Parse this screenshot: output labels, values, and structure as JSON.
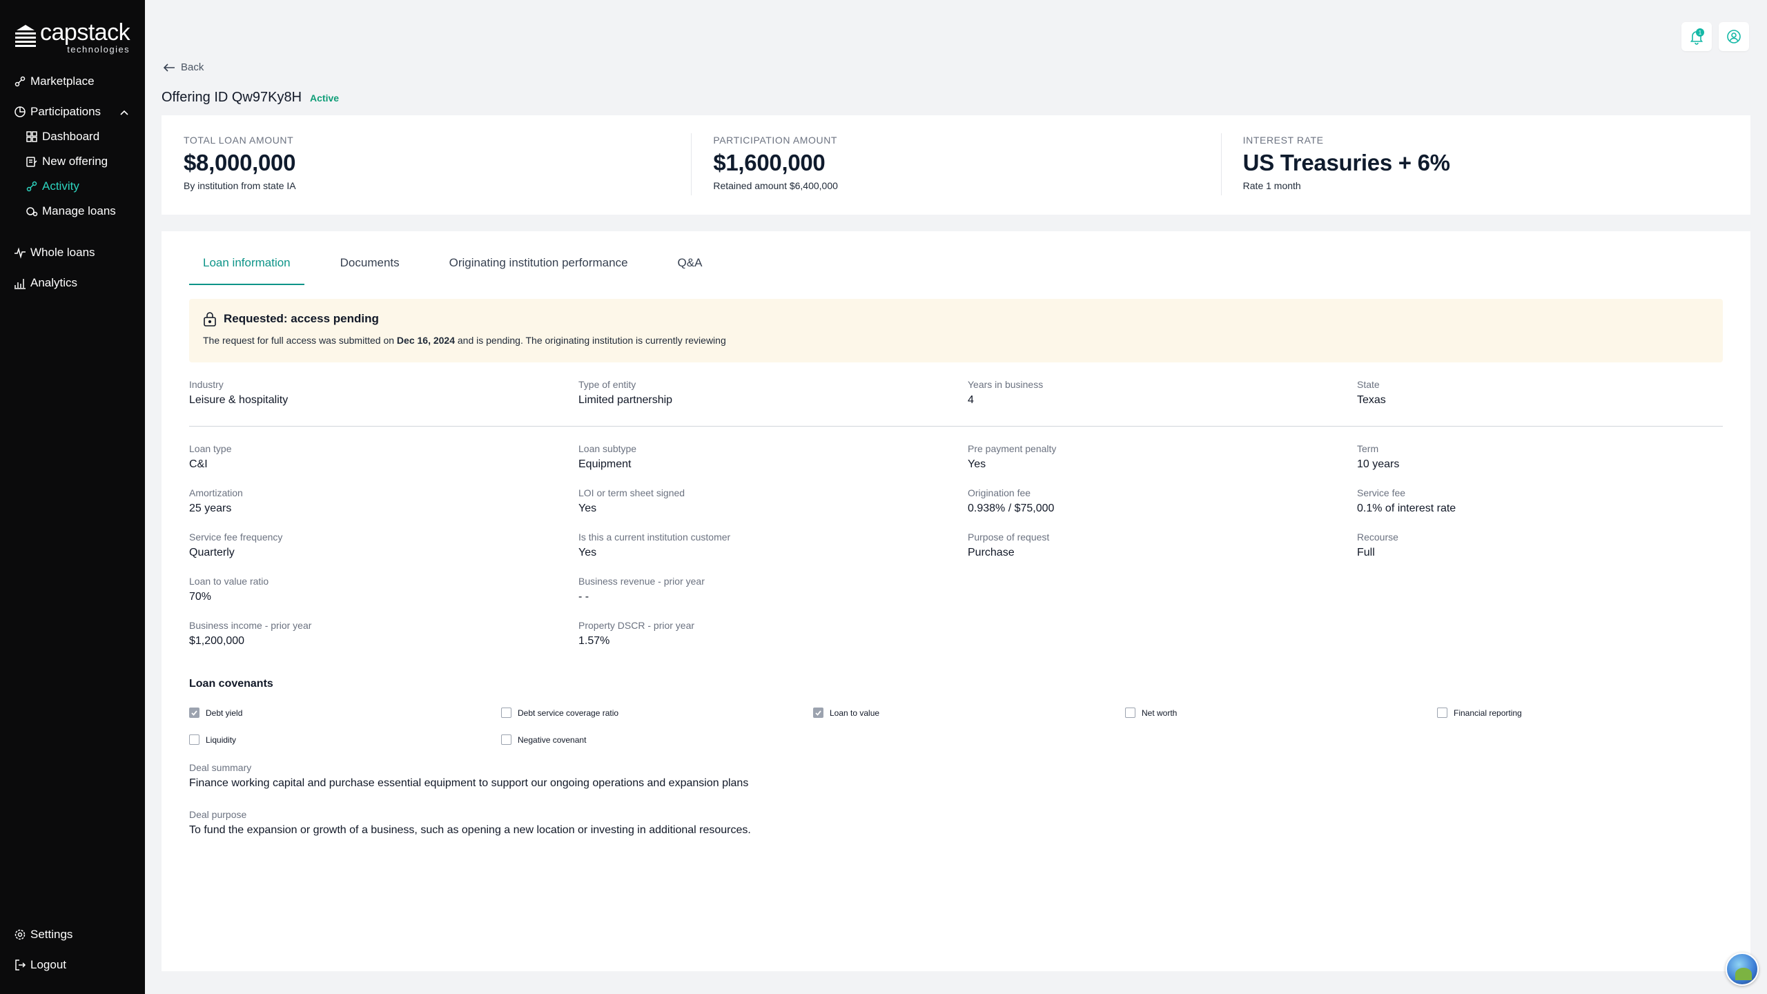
{
  "brand": {
    "name": "capstack",
    "tagline": "technologies"
  },
  "sidebar": {
    "items": [
      {
        "label": "Marketplace",
        "icon": "marketplace-icon"
      },
      {
        "label": "Participations",
        "icon": "participations-icon",
        "expanded": true
      },
      {
        "label": "Dashboard",
        "icon": "dashboard-icon"
      },
      {
        "label": "New offering",
        "icon": "new-offering-icon"
      },
      {
        "label": "Activity",
        "icon": "activity-icon",
        "active": true
      },
      {
        "label": "Manage loans",
        "icon": "manage-loans-icon"
      },
      {
        "label": "Whole loans",
        "icon": "whole-loans-icon"
      },
      {
        "label": "Analytics",
        "icon": "analytics-icon"
      }
    ],
    "bottom": [
      {
        "label": "Settings",
        "icon": "gear-icon"
      },
      {
        "label": "Logout",
        "icon": "logout-icon"
      }
    ]
  },
  "topbar": {
    "notification_count": "1"
  },
  "header": {
    "back_label": "Back",
    "title": "Offering ID Qw97Ky8H",
    "status": "Active"
  },
  "stats": [
    {
      "label": "Total loan amount",
      "value": "$8,000,000",
      "sub": "By institution from state IA"
    },
    {
      "label": "Participation amount",
      "value": "$1,600,000",
      "sub": "Retained amount $6,400,000"
    },
    {
      "label": "Interest rate",
      "value": "US Treasuries + 6%",
      "sub": "Rate 1 month"
    }
  ],
  "tabs": [
    {
      "label": "Loan information",
      "active": true
    },
    {
      "label": "Documents"
    },
    {
      "label": "Originating institution performance"
    },
    {
      "label": "Q&A"
    }
  ],
  "alert": {
    "title": "Requested: access pending",
    "text_before": "The request for full access was submitted on ",
    "date": "Dec 16, 2024",
    "text_after": " and is pending. The originating institution is currently reviewing"
  },
  "company_fields": [
    {
      "label": "Industry",
      "value": "Leisure & hospitality"
    },
    {
      "label": "Type of entity",
      "value": "Limited partnership"
    },
    {
      "label": "Years in business",
      "value": "4"
    },
    {
      "label": "State",
      "value": "Texas"
    }
  ],
  "loan_fields": [
    {
      "label": "Loan type",
      "value": "C&I"
    },
    {
      "label": "Loan subtype",
      "value": "Equipment"
    },
    {
      "label": "Pre payment penalty",
      "value": "Yes"
    },
    {
      "label": "Term",
      "value": "10 years"
    },
    {
      "label": "Amortization",
      "value": "25 years"
    },
    {
      "label": "LOI or term sheet signed",
      "value": "Yes"
    },
    {
      "label": "Origination fee",
      "value": "0.938% / $75,000"
    },
    {
      "label": "Service fee",
      "value": "0.1% of interest rate"
    },
    {
      "label": "Service fee frequency",
      "value": "Quarterly"
    },
    {
      "label": "Is this a current institution customer",
      "value": "Yes"
    },
    {
      "label": "Purpose of request",
      "value": "Purchase"
    },
    {
      "label": "Recourse",
      "value": "Full"
    },
    {
      "label": "Loan to value ratio",
      "value": "70%"
    },
    {
      "label": "Business revenue - prior year",
      "value": "- -"
    },
    {
      "label": "Business income - prior year",
      "value": "$1,200,000"
    },
    {
      "label": "Property DSCR - prior year",
      "value": "1.57%"
    }
  ],
  "covenants": {
    "title": "Loan covenants",
    "items": [
      {
        "label": "Debt yield",
        "checked": true
      },
      {
        "label": "Debt service coverage ratio",
        "checked": false
      },
      {
        "label": "Loan to value",
        "checked": true
      },
      {
        "label": "Net worth",
        "checked": false
      },
      {
        "label": "Financial reporting",
        "checked": false
      },
      {
        "label": "Liquidity",
        "checked": false
      },
      {
        "label": "Negative covenant",
        "checked": false
      }
    ]
  },
  "deal_summary": {
    "label": "Deal summary",
    "value": "Finance working capital and purchase essential equipment to support our ongoing operations and expansion plans"
  },
  "deal_purpose": {
    "label": "Deal purpose",
    "value": "To fund the expansion or growth of a business, such as opening a new location or investing in additional resources."
  },
  "colors": {
    "accent": "#0d9488",
    "sidebar_bg": "#0b0b0c",
    "alert_bg": "#fdf7e9",
    "active_badge": "#0f9d77"
  }
}
